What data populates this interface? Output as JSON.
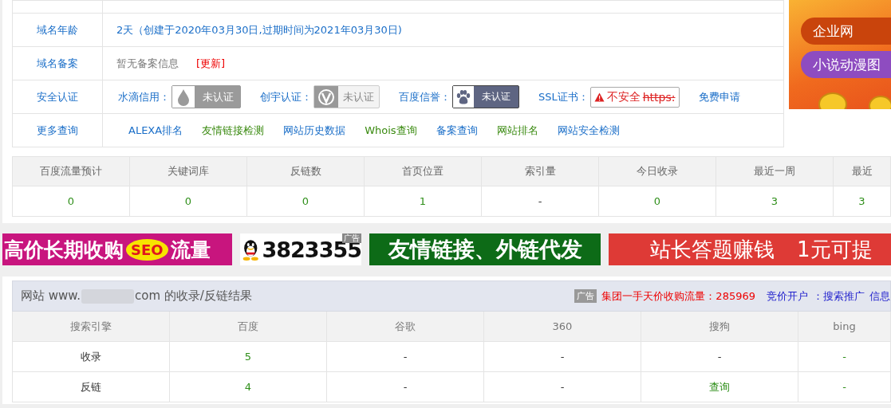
{
  "info_table": {
    "rows": [
      {
        "kind": "text",
        "label": "域名年龄",
        "value": "2天（创建于2020年03月30日,过期时间为2021年03月30日)"
      },
      {
        "kind": "beian",
        "label": "域名备案",
        "value": "暂无备案信息",
        "action": "[更新]"
      },
      {
        "kind": "certs",
        "label": "安全认证",
        "certs": [
          {
            "kind": "drop",
            "label": "水滴信用：",
            "badge": "未认证"
          },
          {
            "kind": "shield",
            "label": "创宇认证：",
            "badge": "未认证"
          },
          {
            "kind": "paw",
            "label": "百度信誉：",
            "badge": "未认证"
          },
          {
            "kind": "ssl",
            "label": "SSL证书：",
            "badge": "不安全",
            "badge_strike": "https:"
          }
        ],
        "apply_link": "免费申请"
      },
      {
        "kind": "links",
        "label": "更多查询",
        "links": [
          {
            "text": "ALEXA排名",
            "kind": "primary"
          },
          {
            "text": "友情链接检测",
            "kind": "secondary"
          },
          {
            "text": "网站历史数据",
            "kind": "primary"
          },
          {
            "text": "Whois查询",
            "kind": "secondary"
          },
          {
            "text": "备案查询",
            "kind": "primary"
          },
          {
            "text": "网站排名",
            "kind": "secondary"
          },
          {
            "text": "网站安全检测",
            "kind": "primary"
          }
        ]
      }
    ]
  },
  "side_ad": {
    "pills": [
      "企业网",
      "小说动漫图"
    ]
  },
  "stats": {
    "columns": [
      "百度流量预计",
      "关键词库",
      "反链数",
      "首页位置",
      "索引量",
      "今日收录",
      "最近一周",
      "最近"
    ],
    "values": [
      {
        "text": "0",
        "link": true
      },
      {
        "text": "0",
        "link": true
      },
      {
        "text": "0",
        "link": true
      },
      {
        "text": "1",
        "link": true
      },
      {
        "text": "-",
        "link": false
      },
      {
        "text": "0",
        "link": true
      },
      {
        "text": "3",
        "link": true
      },
      {
        "text": "3",
        "link": true
      }
    ]
  },
  "banners": [
    {
      "kind": "seo",
      "parts": [
        "高价长期收购",
        "SEO",
        "流量"
      ]
    },
    {
      "kind": "qq",
      "parts": [
        "广告",
        "3823355"
      ]
    },
    {
      "kind": "green",
      "parts": [
        "友情链接、外链代发"
      ]
    },
    {
      "kind": "red",
      "parts": [
        "站长答题赚钱",
        "1元可提"
      ]
    }
  ],
  "results": {
    "title_prefix": "网站 www.",
    "title_suffix": "com 的收录/反链结果",
    "ad_tag": "广告",
    "ad_text": "集团一手天价收购流量：285969",
    "ad_links": [
      "竞价开户",
      "：搜索推广",
      "信息"
    ],
    "columns": [
      "搜索引擎",
      "百度",
      "谷歌",
      "360",
      "搜狗",
      "bing"
    ],
    "rows": [
      {
        "cells": [
          {
            "text": "收录",
            "link": false
          },
          {
            "text": "5",
            "link": true
          },
          {
            "text": "-",
            "link": false
          },
          {
            "text": "-",
            "link": false
          },
          {
            "text": "-",
            "link": false
          },
          {
            "text": "-",
            "link": true
          }
        ]
      },
      {
        "cells": [
          {
            "text": "反链",
            "link": false
          },
          {
            "text": "4",
            "link": true
          },
          {
            "text": "-",
            "link": false
          },
          {
            "text": "-",
            "link": false
          },
          {
            "text": "查询",
            "link": true
          },
          {
            "text": "-",
            "link": true
          }
        ]
      }
    ]
  }
}
